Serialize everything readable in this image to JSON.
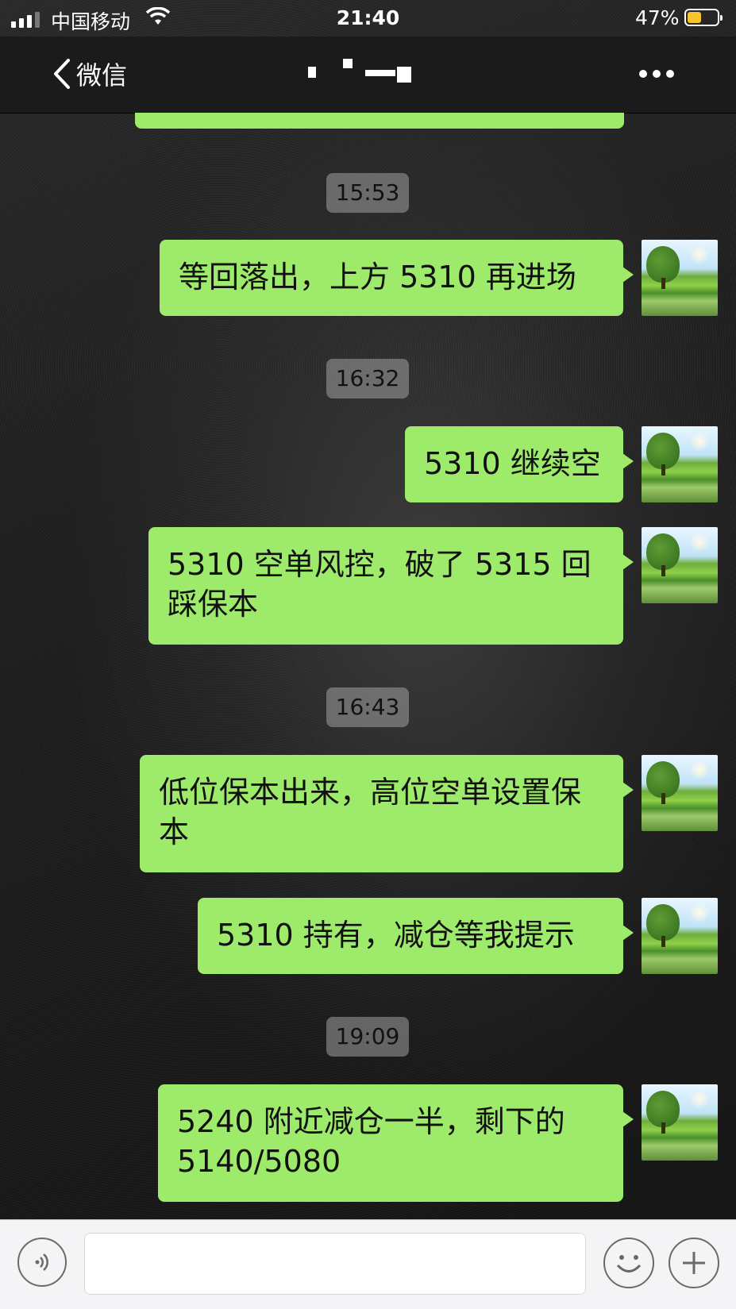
{
  "status_bar": {
    "carrier": "中国移动",
    "time": "21:40",
    "battery_percent": "47%",
    "battery_level": 0.47,
    "icons": [
      "signal-icon",
      "wifi-icon",
      "battery-icon"
    ]
  },
  "nav": {
    "back_label": "微信",
    "icons": [
      "chevron-left-icon",
      "more-icon"
    ]
  },
  "messages": [
    {
      "type": "time",
      "text": "15:53"
    },
    {
      "type": "sent",
      "text": "等回落出，上方 5310 再进场"
    },
    {
      "type": "time",
      "text": "16:32"
    },
    {
      "type": "sent",
      "text": "5310 继续空"
    },
    {
      "type": "sent",
      "text": "5310 空单风控，破了 5315 回踩保本"
    },
    {
      "type": "time",
      "text": "16:43"
    },
    {
      "type": "sent",
      "text": "低位保本出来，高位空单设置保本"
    },
    {
      "type": "sent",
      "text": "5310 持有，减仓等我提示"
    },
    {
      "type": "time",
      "text": "19:09"
    },
    {
      "type": "sent",
      "text": "5240 附近减仓一半，剩下的 5140/5080"
    }
  ],
  "input_bar": {
    "text_value": "",
    "icons": [
      "voice-icon",
      "emoji-icon",
      "plus-icon"
    ]
  },
  "colors": {
    "bubble": "#9eea6a",
    "nav_bg": "#1b1b1b",
    "input_bar_bg": "#f4f4f6",
    "battery_fill": "#f7c32e"
  }
}
